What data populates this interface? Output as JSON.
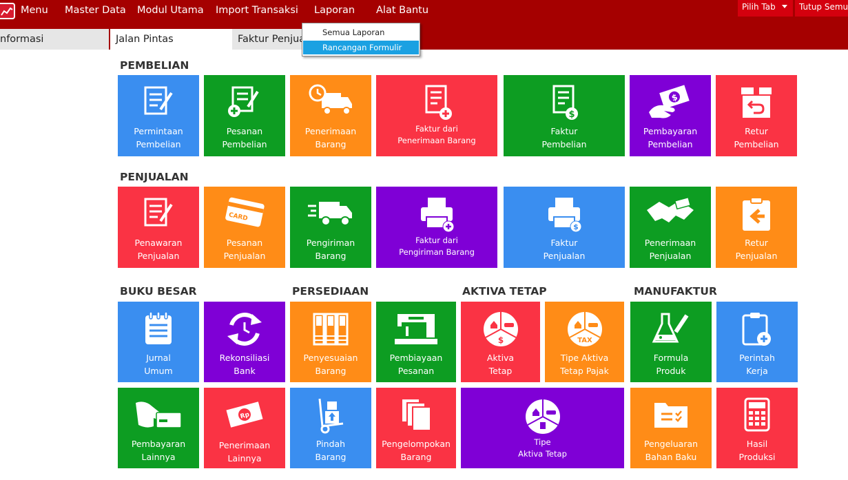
{
  "menubar": {
    "items": [
      "Menu",
      "Master Data",
      "Modul Utama",
      "Import Transaksi",
      "Laporan",
      "Alat Bantu"
    ],
    "pilih_tab": "Pilih Tab",
    "tutup_semua": "Tutup Semua"
  },
  "tabs": [
    "nformasi",
    "Jalan Pintas",
    "Faktur Penjua"
  ],
  "dropdown": {
    "items": [
      "Semua Laporan",
      "Rancangan Formulir"
    ],
    "selected": "Rancangan Formulir"
  },
  "colors": {
    "topbar": "#a50000",
    "blue": "#3a8ef0",
    "green": "#0d9d22",
    "orange": "#ff8c17",
    "red": "#fa3344",
    "purple": "#7f00d6",
    "dropdown_highlight": "#1ba1e2"
  },
  "sections": {
    "pembelian": "PEMBELIAN",
    "penjualan": "PENJUALAN",
    "buku_besar": "BUKU BESAR",
    "persediaan": "PERSEDIAAN",
    "aktiva_tetap": "AKTIVA TETAP",
    "manufaktur": "MANUFAKTUR"
  },
  "tiles": {
    "permintaan_pembelian": "Permintaan\nPembelian",
    "pesanan_pembelian": "Pesanan\nPembelian",
    "penerimaan_barang": "Penerimaan\nBarang",
    "faktur_penerimaan": "Faktur dari\nPenerimaan Barang",
    "faktur_pembelian": "Faktur\nPembelian",
    "pembayaran_pembelian": "Pembayaran\nPembelian",
    "retur_pembelian": "Retur\nPembelian",
    "penawaran_penjualan": "Penawaran\nPenjualan",
    "pesanan_penjualan": "Pesanan\nPenjualan",
    "pengiriman_barang": "Pengiriman\nBarang",
    "faktur_pengiriman": "Faktur dari\nPengiriman Barang",
    "faktur_penjualan": "Faktur\nPenjualan",
    "penerimaan_penjualan": "Penerimaan\nPenjualan",
    "retur_penjualan": "Retur\nPenjualan",
    "jurnal_umum": "Jurnal\nUmum",
    "rekonsiliasi_bank": "Rekonsiliasi\nBank",
    "penyesuaian_barang": "Penyesuaian\nBarang",
    "pembiayaan_pesanan": "Pembiayaan\nPesanan",
    "aktiva_tetap": "Aktiva\nTetap",
    "tipe_aktiva_pajak": "Tipe Aktiva\nTetap Pajak",
    "formula_produk": "Formula\nProduk",
    "perintah_kerja": "Perintah\nKerja",
    "pembayaran_lainnya": "Pembayaran\nLainnya",
    "penerimaan_lainnya": "Penerimaan\nLainnya",
    "pindah_barang": "Pindah\nBarang",
    "pengelompokan_barang": "Pengelompokan\nBarang",
    "tipe_aktiva_tetap": "Tipe\nAktiva Tetap",
    "pengeluaran_bahan_baku": "Pengeluaran\nBahan Baku",
    "hasil_produksi": "Hasil\nProduksi"
  },
  "icon_text": {
    "card": "CARD",
    "tax": "TAX",
    "dollar": "$",
    "rp": "Rp"
  }
}
